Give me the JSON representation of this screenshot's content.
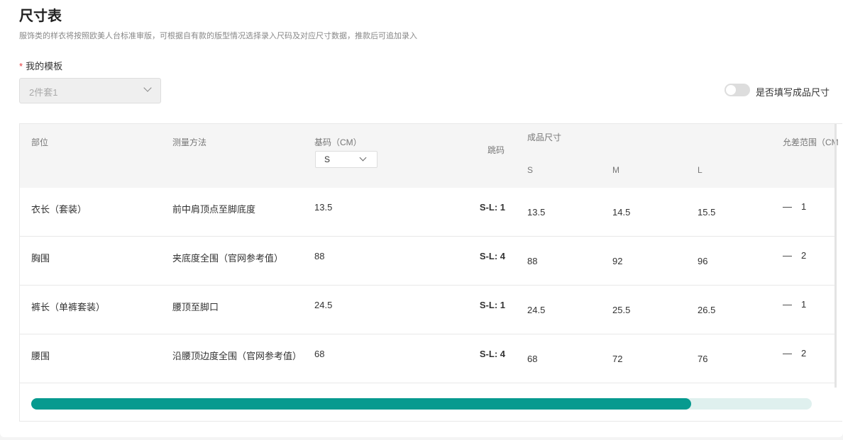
{
  "header": {
    "title": "尺寸表",
    "description": "服饰类的样衣将按照欧美人台标准审版，可根据自有款的版型情况选择录入尺码及对应尺寸数据，推款后可追加录入"
  },
  "template": {
    "required_mark": "*",
    "label": "我的模板",
    "value": "2件套1"
  },
  "toggle": {
    "label": "是否填写成品尺寸",
    "on": false
  },
  "table": {
    "columns": {
      "part": "部位",
      "method": "测量方法",
      "base": "基码（CM）",
      "base_size": "S",
      "jump": "跳码",
      "finished": "成品尺寸",
      "sizes": [
        "S",
        "M",
        "L"
      ],
      "tolerance": "允差范围（CM"
    },
    "rows": [
      {
        "part": "衣长（套装）",
        "method": "前中肩顶点至脚底度",
        "base": "13.5",
        "jump": "S-L: 1",
        "finished": [
          "13.5",
          "14.5",
          "15.5"
        ],
        "tol_sign": "—",
        "tol": "1"
      },
      {
        "part": "胸围",
        "method": "夹底度全围（官网参考值）",
        "base": "88",
        "jump": "S-L: 4",
        "finished": [
          "88",
          "92",
          "96"
        ],
        "tol_sign": "—",
        "tol": "2"
      },
      {
        "part": "裤长（单裤套装）",
        "method": "腰顶至脚口",
        "base": "24.5",
        "jump": "S-L: 1",
        "finished": [
          "24.5",
          "25.5",
          "26.5"
        ],
        "tol_sign": "—",
        "tol": "1"
      },
      {
        "part": "腰围",
        "method": "沿腰顶边度全围（官网参考值）",
        "base": "68",
        "jump": "S-L: 4",
        "finished": [
          "68",
          "72",
          "76"
        ],
        "tol_sign": "—",
        "tol": "2"
      }
    ]
  },
  "scrollbar": {
    "position_percent": 84.5,
    "color": "#079a8f"
  }
}
